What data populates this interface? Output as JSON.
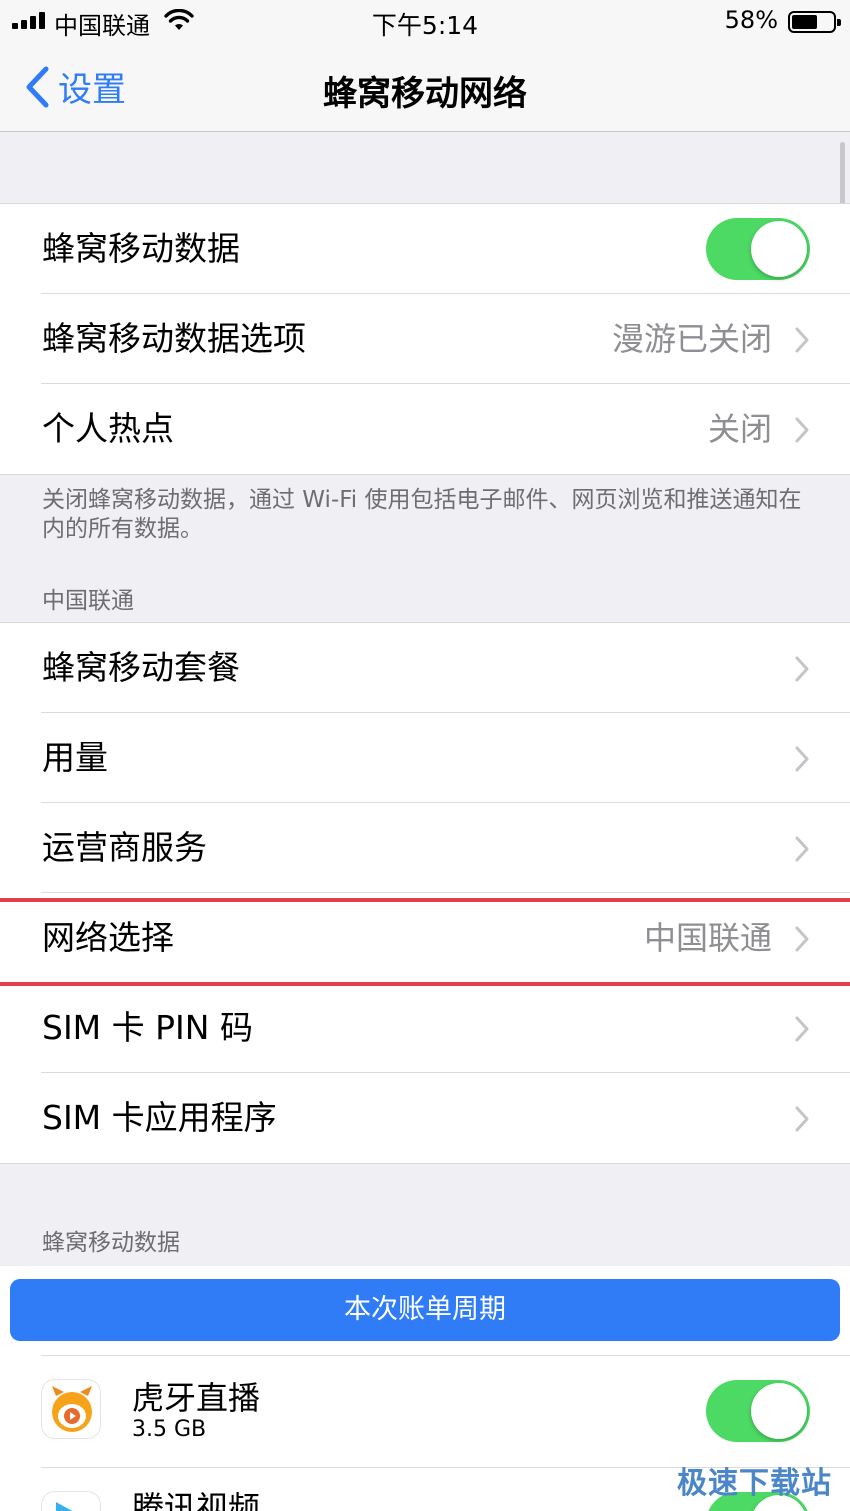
{
  "status_bar": {
    "carrier": "中国联通",
    "time": "下午5:14",
    "battery": "58%",
    "battery_level": 0.58
  },
  "nav": {
    "back_label": "设置",
    "title": "蜂窝移动网络"
  },
  "group1": {
    "cellular_data_label": "蜂窝移动数据",
    "cellular_data_on": true,
    "options_label": "蜂窝移动数据选项",
    "options_value": "漫游已关闭",
    "hotspot_label": "个人热点",
    "hotspot_value": "关闭"
  },
  "footer_note": "关闭蜂窝移动数据，通过 Wi-Fi 使用包括电子邮件、网页浏览和推送通知在内的所有数据。",
  "carrier_section": {
    "header": "中国联通",
    "rows": [
      {
        "label": "蜂窝移动套餐",
        "value": ""
      },
      {
        "label": "用量",
        "value": ""
      },
      {
        "label": "运营商服务",
        "value": ""
      },
      {
        "label": "网络选择",
        "value": "中国联通"
      },
      {
        "label": "SIM 卡 PIN 码",
        "value": ""
      },
      {
        "label": "SIM 卡应用程序",
        "value": ""
      }
    ]
  },
  "data_section": {
    "header": "蜂窝移动数据",
    "period_button": "本次账单周期",
    "apps": [
      {
        "name": "虎牙直播",
        "size": "3.5 GB",
        "enabled": true,
        "icon": "huya-app-icon"
      },
      {
        "name": "腾讯视频",
        "size": "",
        "enabled": true,
        "icon": "tencent-video-app-icon"
      }
    ]
  },
  "watermark": "极速下载站",
  "colors": {
    "accent": "#2f7cf6",
    "toggle_on": "#4cd964",
    "highlight": "#e0404a"
  }
}
